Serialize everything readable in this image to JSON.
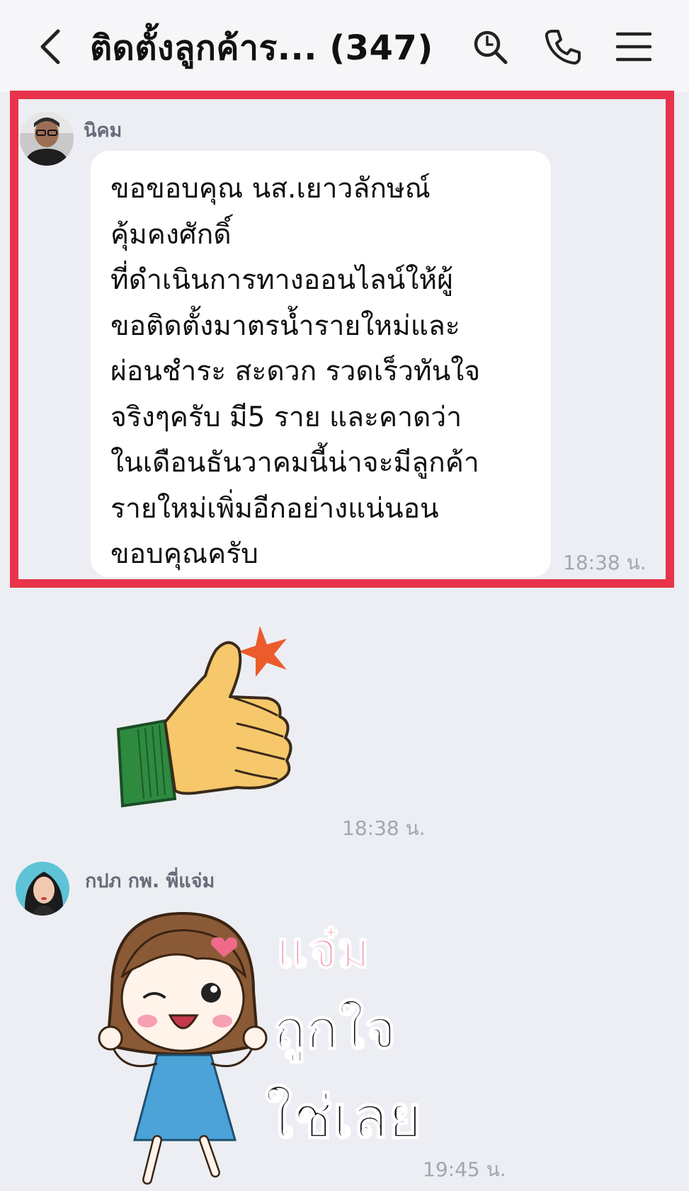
{
  "header": {
    "title": "ติดตั้งลูกค้าร...  (347)"
  },
  "messages": [
    {
      "sender": "นิคม",
      "lines": [
        "ขอขอบคุณ นส.เยาวลักษณ์",
        "คุ้มคงศักดิ์",
        "ที่ดำเนินการทางออนไลน์ให้ผู้",
        "ขอติดตั้งมาตรน้ำรายใหม่และ",
        "ผ่อนชำระ สะดวก รวดเร็วทันใจ",
        "จริงๆครับ  มี5 ราย และคาดว่า",
        "ในเดือนธันวาคมนี้น่าจะมีลูกค้า",
        "รายใหม่เพิ่มอีกอย่างแน่นอน",
        "ขอบคุณครับ"
      ],
      "time": "18:38 น."
    },
    {
      "sticker": "thumbs-up",
      "time": "18:38 น."
    },
    {
      "sender": "กปภ กพ. พี่แจ่ม",
      "sticker_text": [
        "แจ๋ม",
        "ถูกใจ",
        "ใช่เลย"
      ],
      "time": "19:45 น."
    }
  ],
  "colors": {
    "highlight_border": "#e8334a",
    "chat_background": "#eceef3",
    "bubble": "#ffffff"
  }
}
